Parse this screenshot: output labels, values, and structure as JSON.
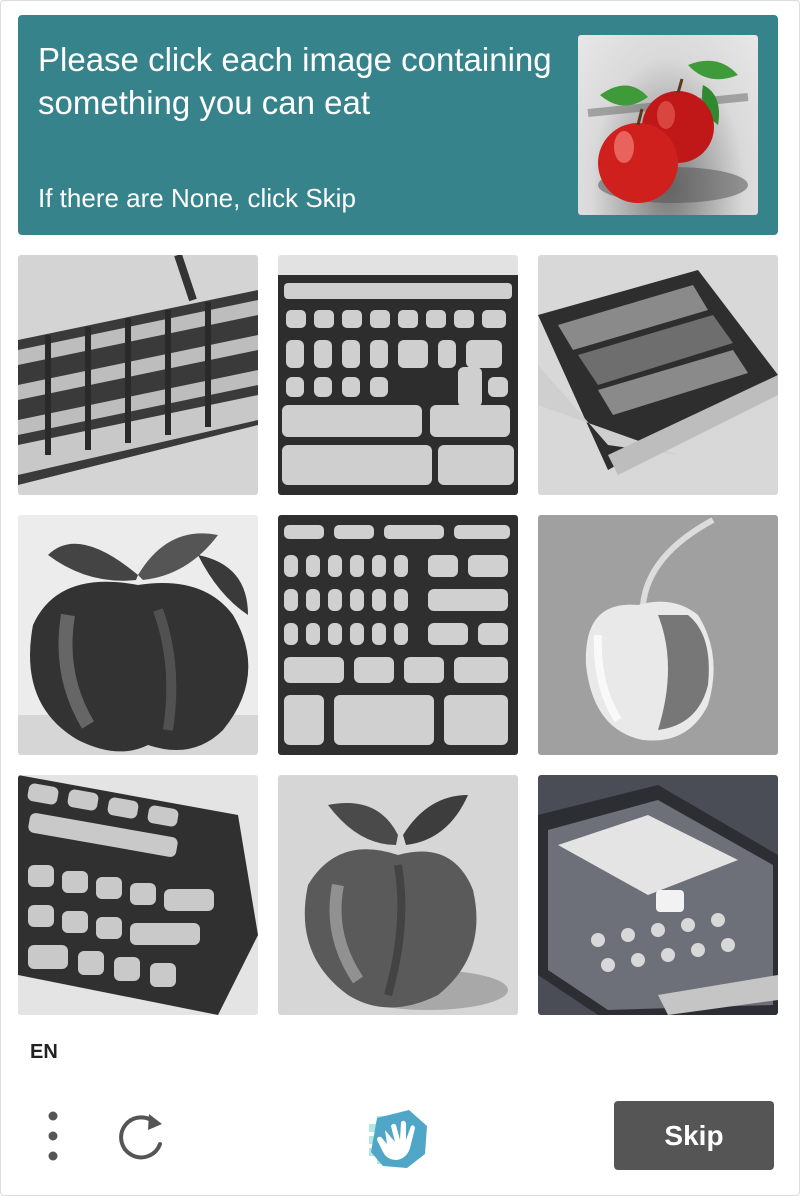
{
  "colors": {
    "header_bg": "#37838c",
    "skip_bg": "#555555",
    "logo_primary": "#4fa6c7",
    "logo_secondary": "#7ad4c9"
  },
  "header": {
    "prompt": "Please click each image containing something you can eat",
    "subtext": "If there are None, click Skip",
    "example_image": "red-apples-image"
  },
  "grid": {
    "images": [
      {
        "subject": "keyboard"
      },
      {
        "subject": "keyboard"
      },
      {
        "subject": "keyboard"
      },
      {
        "subject": "apple"
      },
      {
        "subject": "keyboard"
      },
      {
        "subject": "apple"
      },
      {
        "subject": "keyboard"
      },
      {
        "subject": "apple"
      },
      {
        "subject": "phone"
      }
    ]
  },
  "footer": {
    "language": "EN",
    "menu_icon": "vertical-dots-icon",
    "refresh_icon": "refresh-icon",
    "logo_icon": "hand-logo-icon",
    "skip_label": "Skip"
  }
}
